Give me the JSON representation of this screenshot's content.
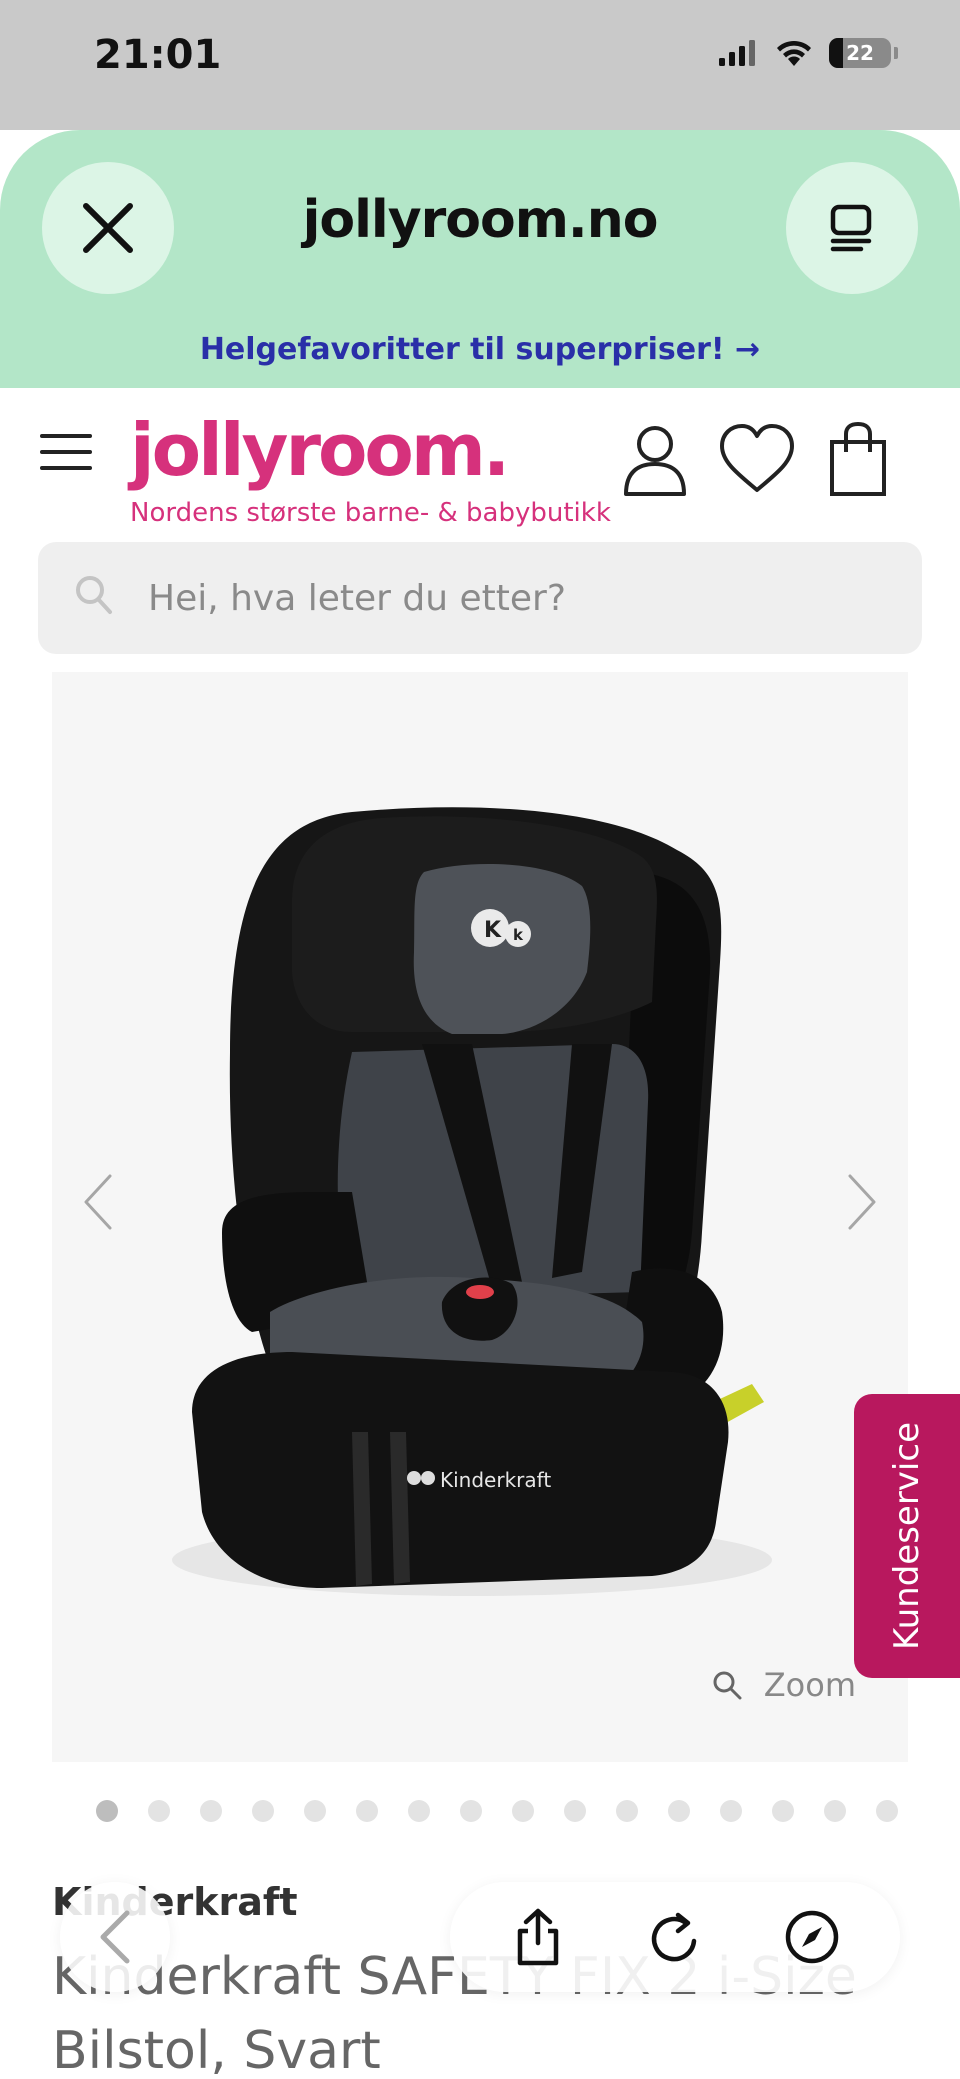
{
  "status_bar": {
    "time": "21:01",
    "battery": "22"
  },
  "browser": {
    "url": "jollyroom.no",
    "promo_text": "Helgefavoritter til superpriser! →"
  },
  "site": {
    "logo": "jollyroom.",
    "tagline": "Nordens største barne- & babybutikk"
  },
  "search": {
    "placeholder": "Hei, hva leter du etter?",
    "value": ""
  },
  "gallery": {
    "zoom_label": "Zoom",
    "image_count": 16,
    "active_index": 0,
    "product_logo_text": "Kinderkraft"
  },
  "kundeservice": {
    "label": "Kundeservice"
  },
  "product": {
    "brand": "Kinderkraft",
    "title": "Kinderkraft SAFETY FIX 2 i-Size Bilstol, Svart"
  },
  "colors": {
    "brand_pink": "#d6317c",
    "browser_green": "#b3e6c8",
    "promo_blue": "#2a2fa8",
    "kundeservice_bg": "#b8185e"
  },
  "icons": [
    "close-icon",
    "tabs-icon",
    "menu-icon",
    "account-icon",
    "heart-icon",
    "bag-icon",
    "search-icon",
    "chevron-left-icon",
    "chevron-right-icon",
    "zoom-icon",
    "back-icon",
    "share-icon",
    "reload-icon",
    "compass-icon"
  ]
}
